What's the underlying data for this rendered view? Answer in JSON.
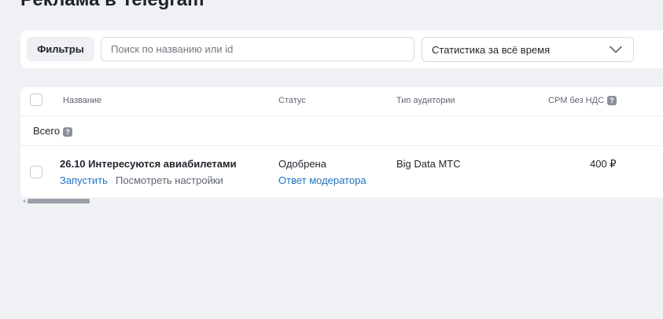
{
  "page": {
    "title": "Реклама в Telegram"
  },
  "filters": {
    "filters_button_label": "Фильтры",
    "search_placeholder": "Поиск по названию или id",
    "period_selected": "Статистика за всё время"
  },
  "table": {
    "columns": [
      {
        "label": "Название"
      },
      {
        "label": "Статус"
      },
      {
        "label": "Тип аудитории"
      },
      {
        "label": "CPM без НДС",
        "has_help": true
      }
    ],
    "total_label": "Всего",
    "rows": [
      {
        "name": "26.10 Интересуются авиабилетами",
        "action_launch": "Запустить",
        "action_settings": "Посмотреть настройки",
        "status": "Одобрена",
        "status_link": "Ответ модератора",
        "audience_type": "Big Data МТС",
        "cpm": "400 ₽"
      }
    ]
  },
  "colors": {
    "background": "#f0f1f5",
    "link": "#1f73c4",
    "text": "#1f2329"
  }
}
